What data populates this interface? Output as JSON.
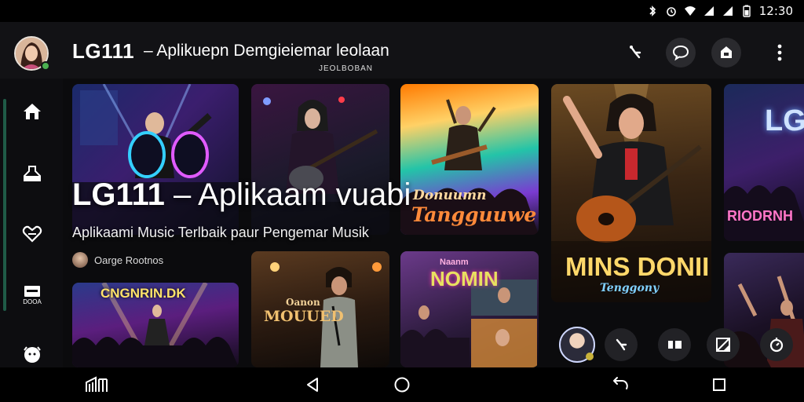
{
  "status_bar": {
    "time": "12:30",
    "icons": [
      "bluetooth-icon",
      "alarm-icon",
      "wifi-icon",
      "signal-icon",
      "signal-icon",
      "battery-icon"
    ]
  },
  "app_bar": {
    "title": "LG111",
    "subtitle": "– Aplikuepn Demgieiemar leolaan",
    "subtitle_line2": "JEOLBOBAN",
    "actions": [
      "share-icon",
      "chat-icon",
      "store-icon",
      "more-vert-icon"
    ]
  },
  "side_rail": {
    "items": [
      {
        "icon": "home-icon",
        "label": ""
      },
      {
        "icon": "library-icon",
        "label": ""
      },
      {
        "icon": "favorite-icon",
        "label": ""
      },
      {
        "icon": "queue-icon",
        "label": "DOOA"
      },
      {
        "icon": "profile-icon",
        "label": ""
      }
    ]
  },
  "hero": {
    "title_bold": "LG111",
    "title_rest": " – Aplikaam vuabi",
    "subtitle": "Aplikaami Music Terlbaik paur Pengemar Musik",
    "meta": "Oarge Rootnos"
  },
  "cards": [
    {
      "caption": ""
    },
    {
      "caption": ""
    },
    {
      "caption": "Donuumn",
      "caption2": "Tangguuwe"
    },
    {
      "caption": "MINS DONII",
      "caption2": "Tenggony"
    },
    {
      "caption": "LGI",
      "caption2": "RIODRNH"
    },
    {
      "caption": "CNGNRIN.DK"
    },
    {
      "caption": "Oanon",
      "caption2": "MOUUED"
    },
    {
      "caption": "Naanm",
      "caption2": "NOMIN"
    },
    {
      "caption": ""
    }
  ],
  "fab_row": [
    "share-icon",
    "album-icon",
    "gallery-icon",
    "timer-icon"
  ],
  "nav_bar": [
    "recents-grid-icon",
    "back-icon",
    "home-circle-icon",
    "rotate-icon",
    "overview-icon"
  ],
  "colors": {
    "accent": "#1f5b47",
    "background": "#0b0b0d",
    "appbar": "#121215"
  }
}
